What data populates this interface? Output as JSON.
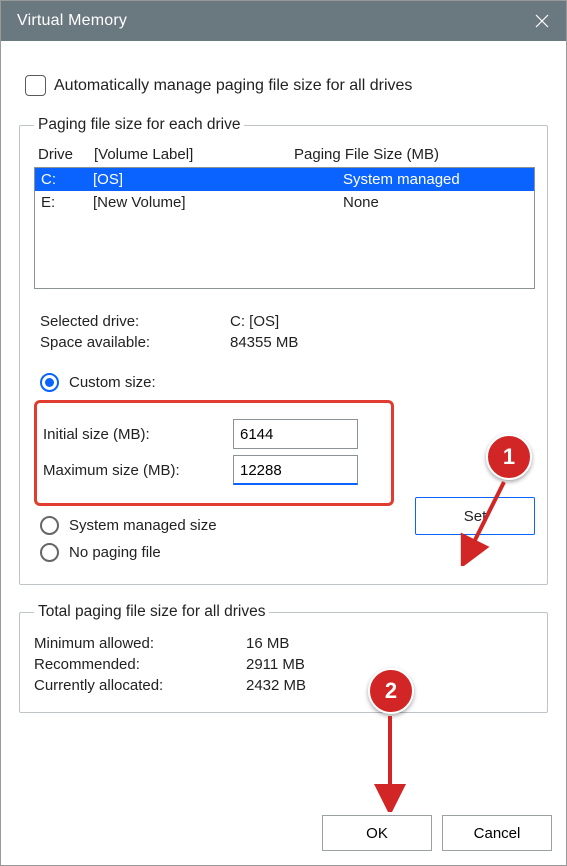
{
  "title": "Virtual Memory",
  "auto_manage_label": "Automatically manage paging file size for all drives",
  "fs1_legend": "Paging file size for each drive",
  "headers": {
    "drive": "Drive",
    "vol": "[Volume Label]",
    "pfs": "Paging File Size (MB)"
  },
  "drives": [
    {
      "d": "C:",
      "vol": "[OS]",
      "pfs": "System managed"
    },
    {
      "d": "E:",
      "vol": "[New Volume]",
      "pfs": "None"
    }
  ],
  "selected_drive_label": "Selected drive:",
  "selected_drive_value": "C:  [OS]",
  "space_label": "Space available:",
  "space_value": "84355 MB",
  "radio_custom": "Custom size:",
  "initial_label": "Initial size (MB):",
  "initial_value": "6144",
  "max_label": "Maximum size (MB):",
  "max_value": "12288",
  "radio_system": "System managed size",
  "radio_none": "No paging file",
  "set_btn": "Set",
  "fs2_legend": "Total paging file size for all drives",
  "min_label": "Minimum allowed:",
  "min_value": "16 MB",
  "rec_label": "Recommended:",
  "rec_value": "2911 MB",
  "cur_label": "Currently allocated:",
  "cur_value": "2432 MB",
  "ok_btn": "OK",
  "cancel_btn": "Cancel",
  "badge1": "1",
  "badge2": "2"
}
